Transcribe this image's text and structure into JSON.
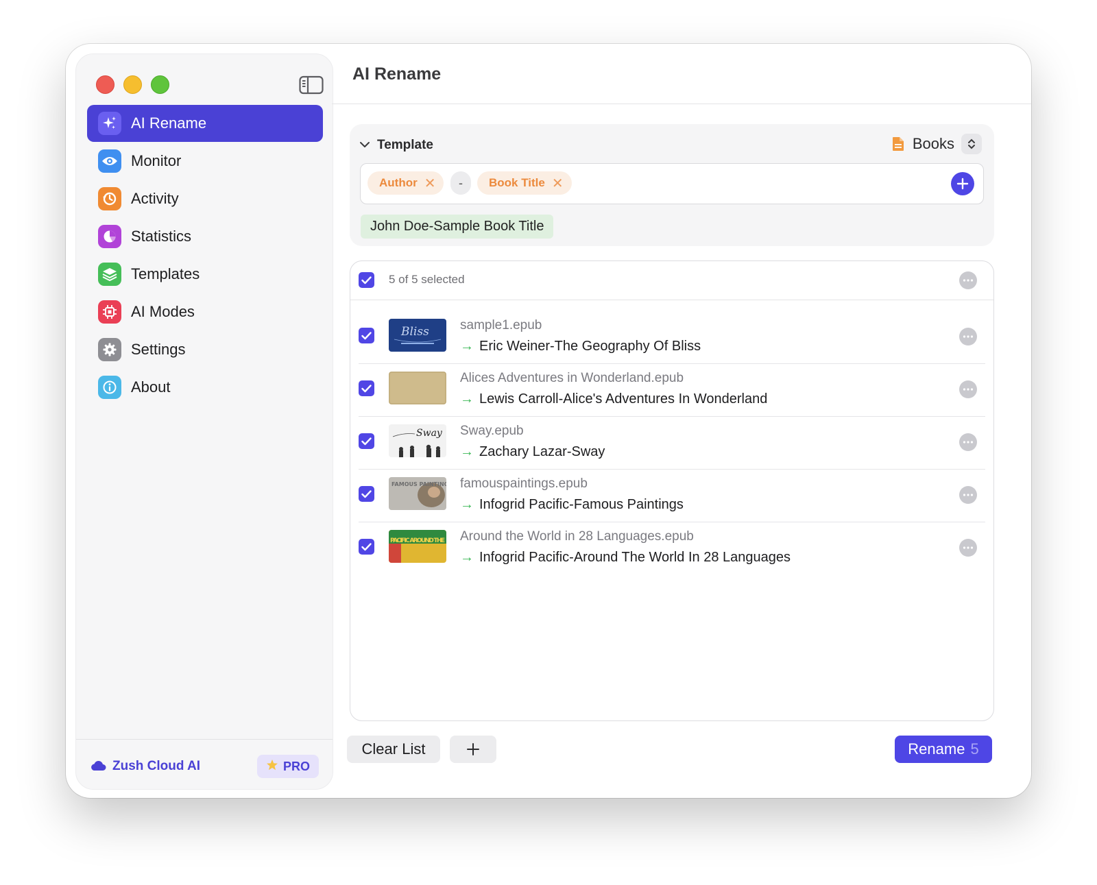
{
  "sidebar": {
    "items": [
      {
        "label": "AI Rename",
        "icon": "sparkles-icon",
        "color": "#6a5ff0",
        "active": true
      },
      {
        "label": "Monitor",
        "icon": "eye-icon",
        "color": "#3f8ff0"
      },
      {
        "label": "Activity",
        "icon": "history-icon",
        "color": "#f08a32"
      },
      {
        "label": "Statistics",
        "icon": "pie-chart-icon",
        "color": "#b143d8"
      },
      {
        "label": "Templates",
        "icon": "layers-icon",
        "color": "#45be58"
      },
      {
        "label": "AI Modes",
        "icon": "chip-icon",
        "color": "#ea3f55"
      },
      {
        "label": "Settings",
        "icon": "gear-icon",
        "color": "#8e8e93"
      },
      {
        "label": "About",
        "icon": "info-icon",
        "color": "#4bb8e8"
      }
    ],
    "footer": {
      "cloud_label": "Zush Cloud AI",
      "pro_label": "PRO"
    }
  },
  "main": {
    "title": "AI Rename",
    "template": {
      "title": "Template",
      "preset": "Books",
      "tokens": [
        {
          "label": "Author"
        },
        {
          "label": "Book Title"
        }
      ],
      "separator": "-",
      "preview": "John Doe-Sample Book Title"
    },
    "list": {
      "selection_text": "5 of 5 selected",
      "files": [
        {
          "original": "sample1.epub",
          "new_name": "Eric Weiner-The Geography Of Bliss",
          "thumb": "Bliss"
        },
        {
          "original": "Alices Adventures in Wonderland.epub",
          "new_name": "Lewis Carroll-Alice's Adventures In Wonderland",
          "thumb": ""
        },
        {
          "original": "Sway.epub",
          "new_name": "Zachary Lazar-Sway",
          "thumb": "Sway"
        },
        {
          "original": "famouspaintings.epub",
          "new_name": "Infogrid Pacific-Famous Paintings",
          "thumb": "FAMOUS PAINTINGS"
        },
        {
          "original": "Around the World in 28 Languages.epub",
          "new_name": "Infogrid Pacific-Around The World In 28 Languages",
          "thumb": "PACIFIC AROUND THE"
        }
      ]
    },
    "actions": {
      "clear_label": "Clear List",
      "add_label": "+",
      "rename_label": "Rename",
      "rename_count": "5"
    }
  },
  "colors": {
    "accent": "#4e46e5",
    "token_text": "#ec8a3d",
    "arrow": "#3db857"
  }
}
